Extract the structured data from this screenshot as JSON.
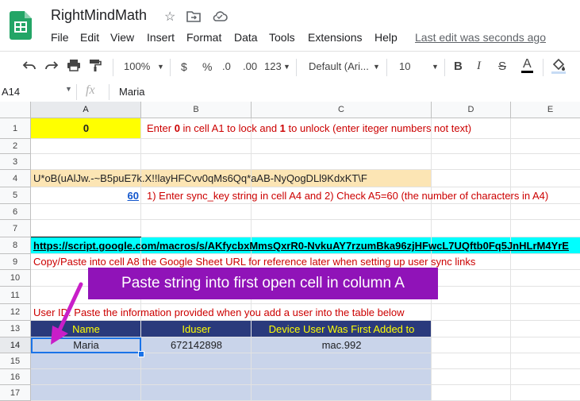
{
  "app": {
    "title": "RightMindMath",
    "menus": [
      "File",
      "Edit",
      "View",
      "Insert",
      "Format",
      "Data",
      "Tools",
      "Extensions",
      "Help"
    ],
    "last_edit": "Last edit was seconds ago",
    "icons": [
      "sheets-logo-icon",
      "star-icon",
      "move-folder-icon",
      "cloud-status-icon"
    ]
  },
  "toolbar": {
    "zoom": "100%",
    "currency": "$",
    "percent": "%",
    "decimal_decrease": ".0",
    "decimal_increase": ".00",
    "more_formats": "123",
    "font": "Default (Ari...",
    "font_size": "10",
    "bold": "B",
    "italic": "I",
    "strikethrough": "S",
    "text_color": "A"
  },
  "formula_bar": {
    "cell_ref": "A14",
    "fx": "fx",
    "value": "Maria"
  },
  "columns": [
    "A",
    "B",
    "C",
    "D",
    "E"
  ],
  "rows": [
    "1",
    "2",
    "3",
    "4",
    "5",
    "6",
    "7",
    "8",
    "9",
    "10",
    "11",
    "12",
    "13",
    "14",
    "15",
    "16",
    "17"
  ],
  "cells": {
    "a1": "0",
    "b1_parts": [
      "Enter ",
      "0",
      " in cell A1 to lock and ",
      "1",
      " to unlock (enter iteger numbers not text)"
    ],
    "a4": "U*oB(uAlJw.-~B5puE7k.X!!layHFCvv0qMs6Qq*aAB-NyQogDLl9KdxKT\\F",
    "a5": "60",
    "b5": "1) Enter sync_key string in cell A4  and  2) Check A5=60 (the number of characters in A4)",
    "a8": "https://script.google.com/macros/s/AKfycbxMmsQxrR0-NvkuAY7rzumBka96zjHFwcL7UQftb0Fq5JnHLrM4YrE",
    "a9": "Copy/Paste into cell A8 the Google Sheet URL for reference later when setting up user sync links",
    "a12": "User ID: Paste the information provided when you add a user into the table below",
    "hdr_name": "Name",
    "hdr_iduser": "Iduser",
    "hdr_device": "Device User Was First Added to",
    "a14": "Maria",
    "b14": "672142898",
    "c14": "mac.992"
  },
  "callout": {
    "text": "Paste string into first open cell in column A",
    "color": "#9013b8"
  },
  "colors": {
    "yellow": "#ffff00",
    "tan": "#fce5b4",
    "cyan": "#00ffff",
    "navy_header": "#2a3a7c",
    "header_text": "#ffff00",
    "table_fill": "#c9d4ea",
    "red_text": "#cc0000",
    "arrow": "#c81ec8"
  }
}
